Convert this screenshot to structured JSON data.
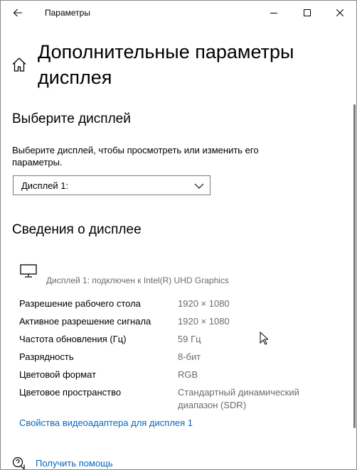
{
  "window": {
    "app_title": "Параметры"
  },
  "header": {
    "title": "Дополнительные параметры дисплея"
  },
  "choose_display": {
    "section_title": "Выберите дисплей",
    "description": "Выберите дисплей, чтобы просмотреть или изменить его параметры.",
    "dropdown": {
      "selected": "Дисплей 1:"
    }
  },
  "display_info": {
    "section_title": "Сведения о дисплее",
    "connected_text": "Дисплей 1: подключен к Intel(R) UHD Graphics",
    "rows": [
      {
        "label": "Разрешение рабочего стола",
        "value": "1920 × 1080"
      },
      {
        "label": "Активное разрешение сигнала",
        "value": "1920 × 1080"
      },
      {
        "label": "Частота обновления (Гц)",
        "value": "59 Гц"
      },
      {
        "label": "Разрядность",
        "value": "8-бит"
      },
      {
        "label": "Цветовой формат",
        "value": "RGB"
      },
      {
        "label": "Цветовое пространство",
        "value": "Стандартный динамический диапазон (SDR)"
      }
    ],
    "adapter_link": "Свойства видеоадаптера для дисплея 1"
  },
  "help": {
    "link": "Получить помощь"
  },
  "icons": {
    "back": "back-arrow-icon",
    "home": "home-icon",
    "monitor": "monitor-icon",
    "chevron": "chevron-down-icon",
    "help": "help-chat-icon"
  },
  "colors": {
    "accent": "#0067c0",
    "secondary_text": "#6b6b6b"
  }
}
